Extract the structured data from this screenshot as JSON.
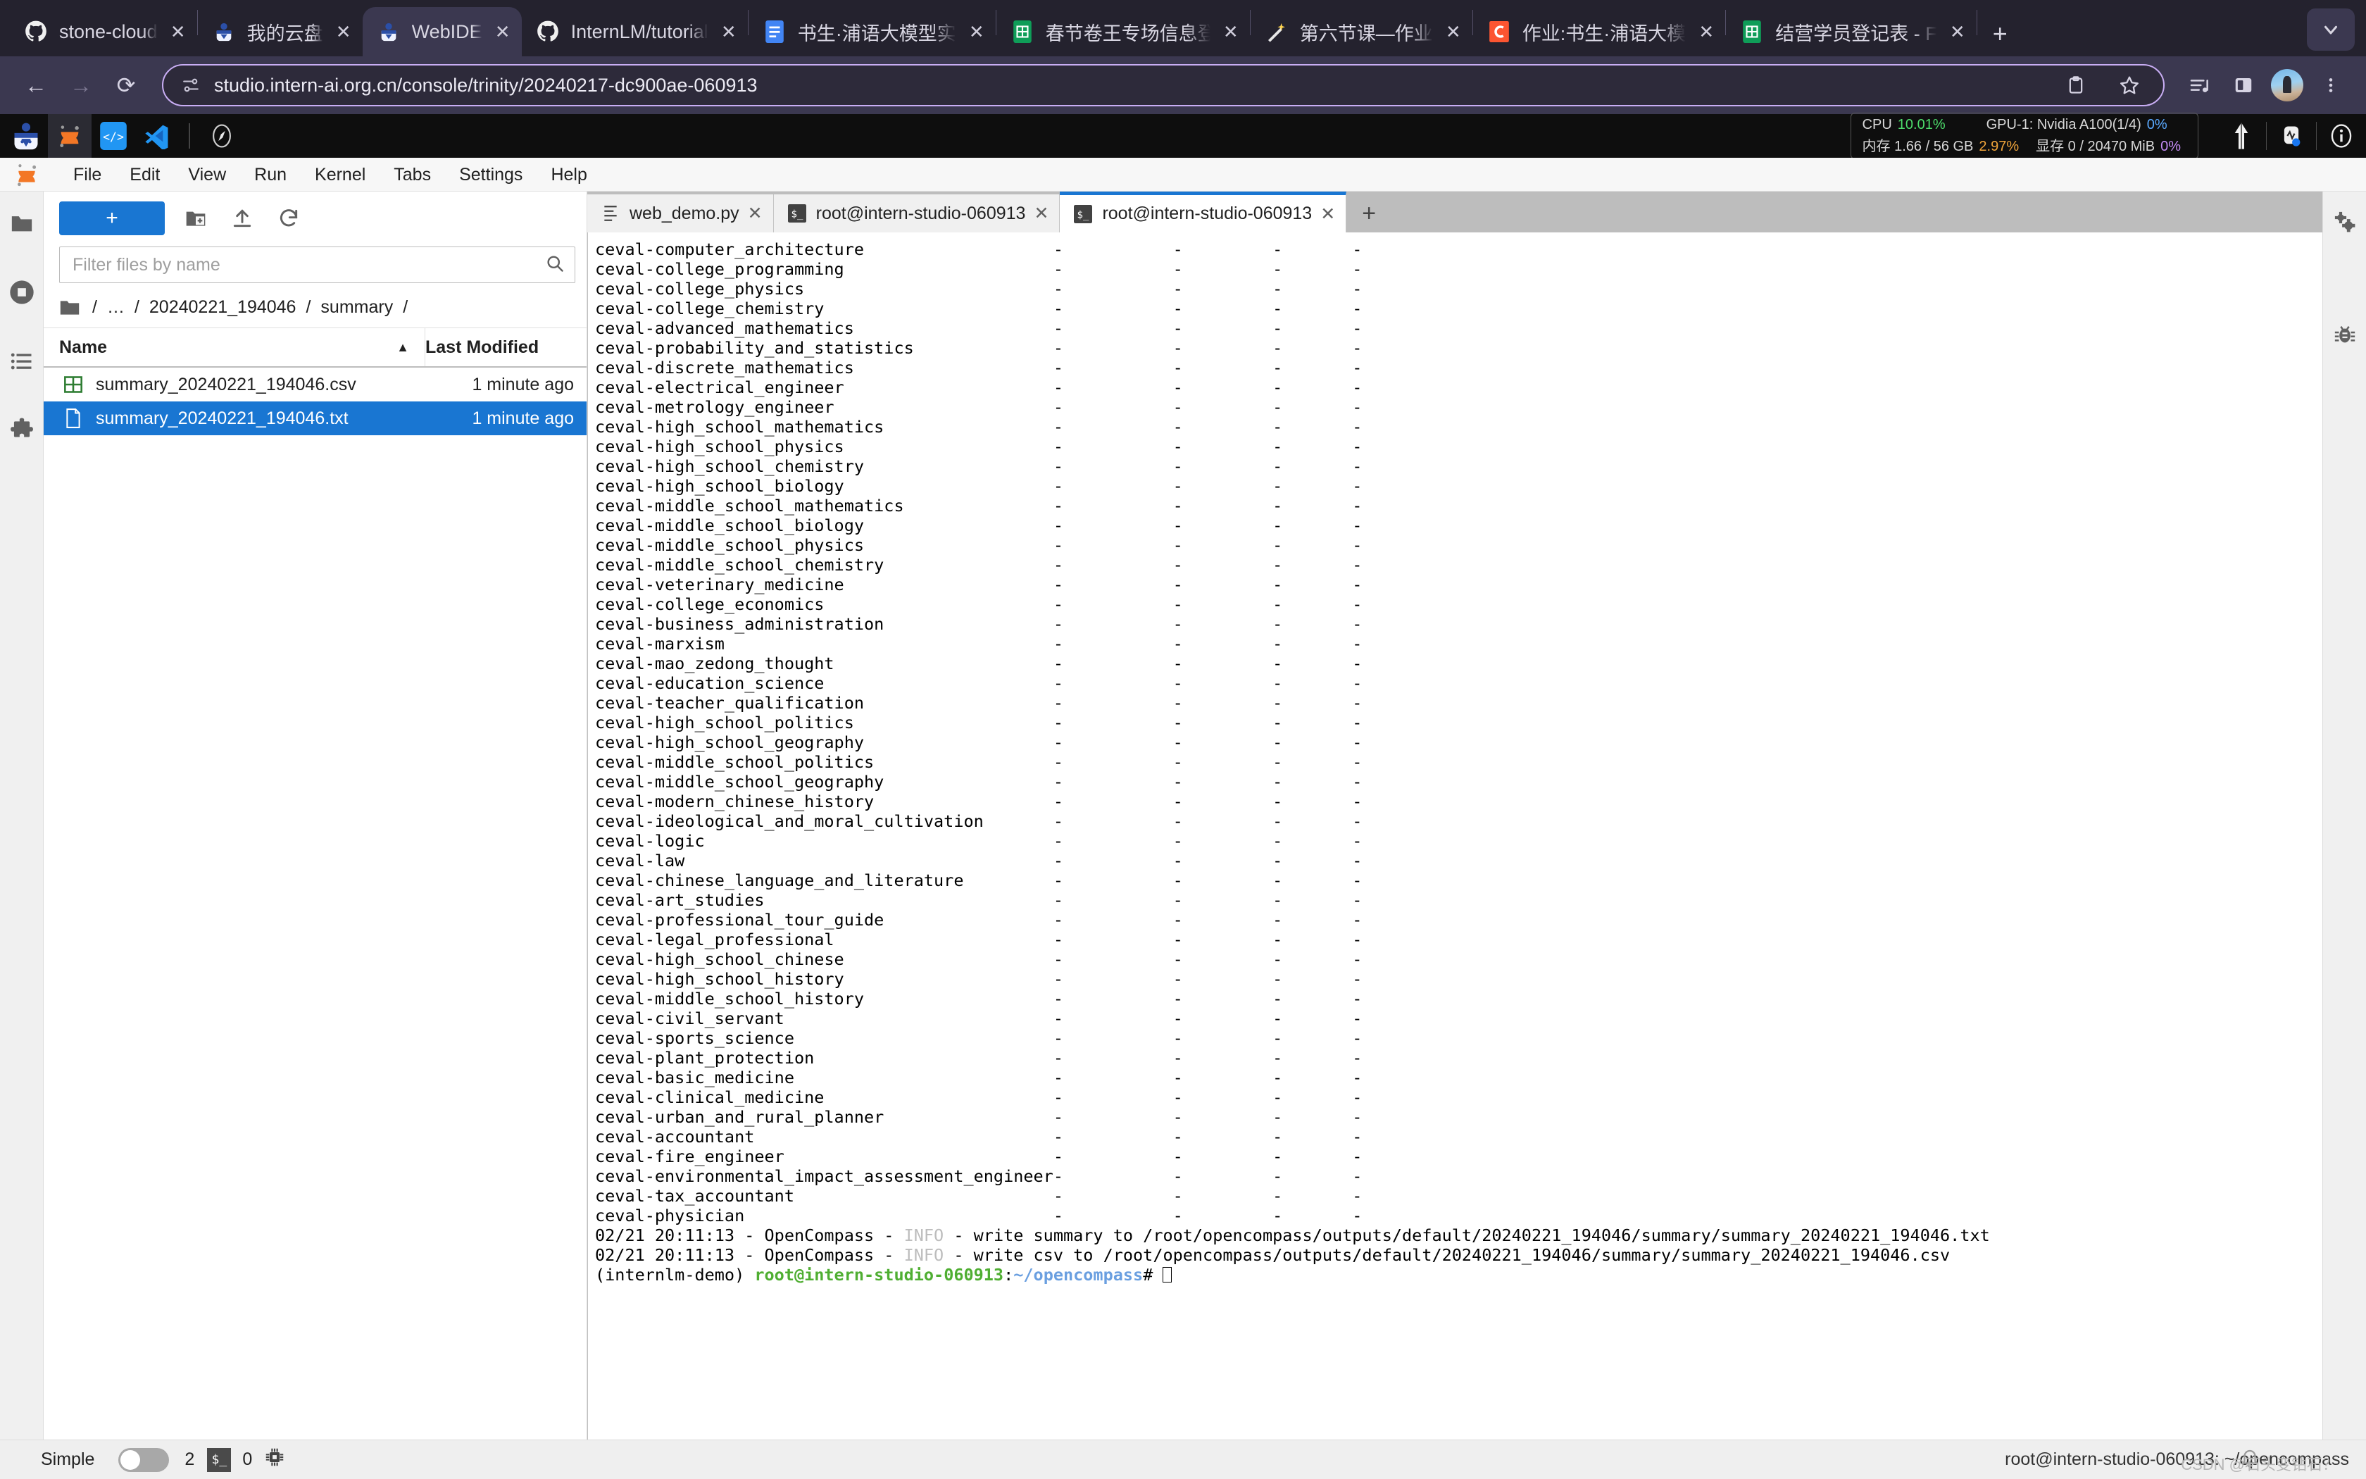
{
  "browser": {
    "tabs": [
      {
        "title": "stone-cloud",
        "favicon": "github-icon",
        "active": false
      },
      {
        "title": "我的云盘",
        "favicon": "intern-icon",
        "active": false
      },
      {
        "title": "WebIDE",
        "favicon": "intern-icon",
        "active": true
      },
      {
        "title": "InternLM/tutorial",
        "favicon": "github-icon",
        "active": false
      },
      {
        "title": "书生·浦语大模型实",
        "favicon": "docs-icon",
        "active": false
      },
      {
        "title": "春节卷王专场信息登",
        "favicon": "sheets-icon",
        "active": false
      },
      {
        "title": "第六节课—作业",
        "favicon": "magic-icon",
        "active": false
      },
      {
        "title": "作业:书生·浦语大模",
        "favicon": "csdn-icon",
        "active": false
      },
      {
        "title": "结营学员登记表 - F",
        "favicon": "sheets-icon",
        "active": false
      }
    ],
    "close_label": "✕",
    "newtab_label": "+",
    "tabs_dropdown": "chevron-down-icon",
    "nav": {
      "back": "←",
      "forward": "→",
      "reload": "⟳"
    },
    "omnibox": {
      "url": "studio.intern-ai.org.cn/console/trinity/20240217-dc900ae-060913",
      "site_icon": "site-settings-icon",
      "copy_icon": "clipboard-icon",
      "bookmark_icon": "star-icon"
    },
    "toolbar_icons": [
      "media-list-icon",
      "side-panel-icon",
      "profile-avatar",
      "more-menu-icon"
    ]
  },
  "appbar": {
    "logo": "intern-studio-logo",
    "launchers": [
      "jupyter-icon",
      "code-server-icon",
      "vscode-icon"
    ],
    "compass_icon": "compass-icon",
    "resources": {
      "cpu_label": "CPU",
      "cpu_value": "10.01%",
      "gpu_label": "GPU-1: Nvidia A100(1/4)",
      "gpu_value": "0%",
      "mem_label": "内存 1.66 / 56 GB",
      "mem_value": "2.97%",
      "vram_label": "显存 0 / 20470 MiB",
      "vram_value": "0%"
    },
    "icons": [
      "upload-arrow-icon",
      "monitor-icon",
      "info-icon"
    ]
  },
  "menubar": {
    "logo": "jupyter-logo",
    "items": [
      "File",
      "Edit",
      "View",
      "Run",
      "Kernel",
      "Tabs",
      "Settings",
      "Help"
    ]
  },
  "left_rail": {
    "items": [
      "file-browser-icon",
      "running-terminals-icon",
      "table-of-contents-icon",
      "extension-manager-icon"
    ]
  },
  "right_rail": {
    "items": [
      "property-inspector-icon",
      "debugger-icon"
    ]
  },
  "file_browser": {
    "new_button": "+",
    "toolbar_icons": [
      "new-folder-icon",
      "upload-icon",
      "refresh-icon"
    ],
    "filter_placeholder": "Filter files by name",
    "filter_value": "",
    "search_icon": "search-icon",
    "breadcrumb": [
      "/",
      "…",
      "/",
      "20240221_194046",
      "/",
      "summary",
      "/"
    ],
    "columns": {
      "name": "Name",
      "last_modified": "Last Modified"
    },
    "sort_arrow": "▲",
    "rows": [
      {
        "icon": "csv-file-icon",
        "name": "summary_20240221_194046.csv",
        "modified": "1 minute ago",
        "selected": false
      },
      {
        "icon": "text-file-icon",
        "name": "summary_20240221_194046.txt",
        "modified": "1 minute ago",
        "selected": true
      }
    ]
  },
  "dock": {
    "tabs": [
      {
        "label": "web_demo.py",
        "icon": "python-file-icon",
        "active": false
      },
      {
        "label": "root@intern-studio-060913",
        "icon": "terminal-icon",
        "active": false
      },
      {
        "label": "root@intern-studio-060913",
        "icon": "terminal-icon",
        "active": true
      }
    ],
    "close_label": "✕",
    "add_label": "+"
  },
  "terminal": {
    "dash": "-",
    "rows": [
      "ceval-computer_architecture",
      "ceval-college_programming",
      "ceval-college_physics",
      "ceval-college_chemistry",
      "ceval-advanced_mathematics",
      "ceval-probability_and_statistics",
      "ceval-discrete_mathematics",
      "ceval-electrical_engineer",
      "ceval-metrology_engineer",
      "ceval-high_school_mathematics",
      "ceval-high_school_physics",
      "ceval-high_school_chemistry",
      "ceval-high_school_biology",
      "ceval-middle_school_mathematics",
      "ceval-middle_school_biology",
      "ceval-middle_school_physics",
      "ceval-middle_school_chemistry",
      "ceval-veterinary_medicine",
      "ceval-college_economics",
      "ceval-business_administration",
      "ceval-marxism",
      "ceval-mao_zedong_thought",
      "ceval-education_science",
      "ceval-teacher_qualification",
      "ceval-high_school_politics",
      "ceval-high_school_geography",
      "ceval-middle_school_politics",
      "ceval-middle_school_geography",
      "ceval-modern_chinese_history",
      "ceval-ideological_and_moral_cultivation",
      "ceval-logic",
      "ceval-law",
      "ceval-chinese_language_and_literature",
      "ceval-art_studies",
      "ceval-professional_tour_guide",
      "ceval-legal_professional",
      "ceval-high_school_chinese",
      "ceval-high_school_history",
      "ceval-middle_school_history",
      "ceval-civil_servant",
      "ceval-sports_science",
      "ceval-plant_protection",
      "ceval-basic_medicine",
      "ceval-clinical_medicine",
      "ceval-urban_and_rural_planner",
      "ceval-accountant",
      "ceval-fire_engineer",
      "ceval-environmental_impact_assessment_engineer",
      "ceval-tax_accountant",
      "ceval-physician"
    ],
    "log_lines": [
      {
        "prefix": "02/21 20:11:13 - OpenCompass - ",
        "level": "INFO",
        "rest": " - write summary to /root/opencompass/outputs/default/20240221_194046/summary/summary_20240221_194046.txt"
      },
      {
        "prefix": "02/21 20:11:13 - OpenCompass - ",
        "level": "INFO",
        "rest": " - write csv to /root/opencompass/outputs/default/20240221_194046/summary/summary_20240221_194046.csv"
      }
    ],
    "prompt": {
      "env": "(internlm-demo) ",
      "user_host": "root@intern-studio-060913",
      "colon": ":",
      "path": "~/opencompass",
      "sigil": "# "
    }
  },
  "statusbar": {
    "simple_label": "Simple",
    "toggle_state": "off",
    "kernel_count": "2",
    "terminal_icon": "terminal-icon",
    "terminal_count": "0",
    "cpu_icon": "cpu-icon",
    "right_text": "root@intern-studio-060913: ~/opencompass",
    "watermark": "CSDN @石头变钻石？"
  }
}
